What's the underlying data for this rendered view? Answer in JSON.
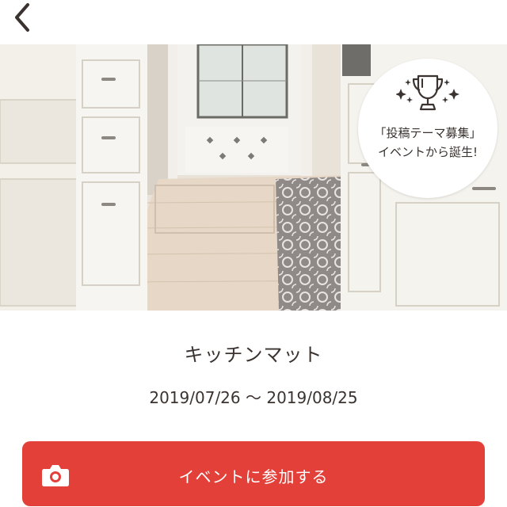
{
  "nav": {
    "back_icon": "chevron-left-icon"
  },
  "badge": {
    "icon": "trophy-icon",
    "line1": "「投稿テーマ募集」",
    "line2": "イベントから誕生!"
  },
  "event": {
    "title": "キッチンマット",
    "period": "2019/07/26 ～ 2019/08/25"
  },
  "join_button": {
    "icon": "camera-icon",
    "label": "イベントに参加する",
    "color": "#e4403a"
  }
}
